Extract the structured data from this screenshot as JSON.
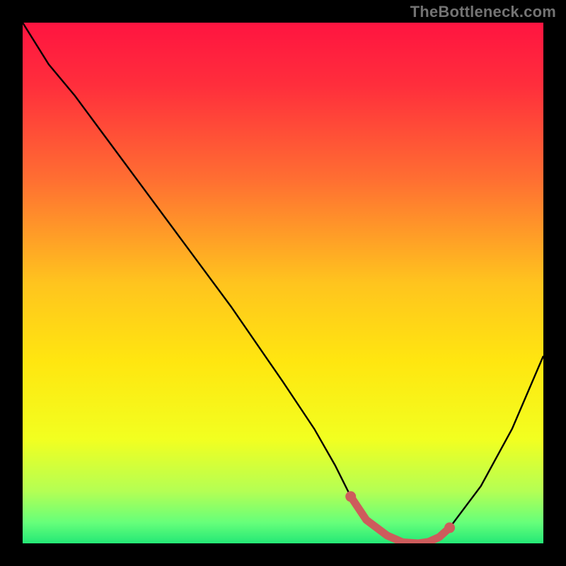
{
  "watermark": "TheBottleneck.com",
  "chart_data": {
    "type": "line",
    "title": "",
    "xlabel": "",
    "ylabel": "",
    "xlim": [
      0,
      100
    ],
    "ylim": [
      0,
      100
    ],
    "grid": false,
    "series": [
      {
        "name": "curve",
        "x": [
          0,
          5,
          10,
          20,
          30,
          40,
          50,
          56,
          60,
          63,
          66,
          70,
          73,
          76,
          78,
          82,
          88,
          94,
          100
        ],
        "y": [
          100,
          92,
          86,
          72.5,
          59,
          45.5,
          31,
          22,
          15,
          9,
          4.5,
          1.5,
          0.2,
          0,
          0.3,
          3,
          11,
          22,
          36
        ],
        "color": "#000000"
      }
    ],
    "highlight": {
      "name": "flat-region",
      "x": [
        63,
        66,
        70,
        73,
        76,
        78,
        80,
        82
      ],
      "y": [
        9,
        4.5,
        1.5,
        0.2,
        0,
        0.3,
        1.2,
        3
      ],
      "color": "#CD5C5C"
    },
    "background_gradient": {
      "stops": [
        {
          "pos": 0.0,
          "color": "#FF1440"
        },
        {
          "pos": 0.12,
          "color": "#FF2E3C"
        },
        {
          "pos": 0.3,
          "color": "#FF6E32"
        },
        {
          "pos": 0.5,
          "color": "#FFC41E"
        },
        {
          "pos": 0.65,
          "color": "#FFE610"
        },
        {
          "pos": 0.8,
          "color": "#F2FF20"
        },
        {
          "pos": 0.9,
          "color": "#B4FF54"
        },
        {
          "pos": 0.96,
          "color": "#66FF7A"
        },
        {
          "pos": 1.0,
          "color": "#24E876"
        }
      ]
    }
  }
}
